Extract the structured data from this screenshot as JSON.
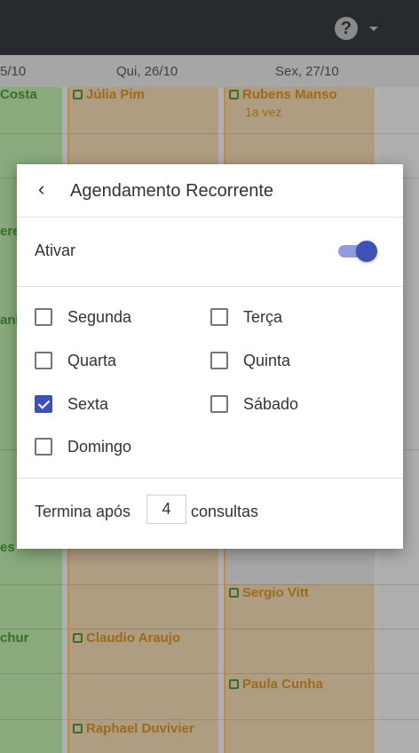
{
  "calendar": {
    "header": {
      "col0": "5/10",
      "col1": "Qui, 26/10",
      "col2": "Sex, 27/10"
    },
    "events": {
      "col0_top": "Costa",
      "col0_mid1": "ere",
      "col0_mid2": "anh",
      "col0_low1": "es",
      "col0_low2": "chur",
      "col1_top": "Júlia Pim",
      "col1_mid": "Claudio Araujo",
      "col1_low": "Raphael Duvivier",
      "col2_top": "Rubens Manso",
      "col2_top_sub": "1a vez",
      "col2_mid": "Sergio Vitt",
      "col2_low": "Paula Cunha"
    }
  },
  "dialog": {
    "title": "Agendamento Recorrente",
    "ativar_label": "Ativar",
    "ativar_on": true,
    "days": [
      {
        "label": "Segunda",
        "checked": false
      },
      {
        "label": "Terça",
        "checked": false
      },
      {
        "label": "Quarta",
        "checked": false
      },
      {
        "label": "Quinta",
        "checked": false
      },
      {
        "label": "Sexta",
        "checked": true
      },
      {
        "label": "Sábado",
        "checked": false
      },
      {
        "label": "Domingo",
        "checked": false
      }
    ],
    "ends_prefix": "Termina após",
    "ends_value": "4",
    "ends_suffix": "consultas"
  },
  "colors": {
    "accent": "#3f51b5",
    "topbar": "#2e3135",
    "event_orange": "#c8b393",
    "event_green": "#9bc28f"
  },
  "icons": {
    "help": "question-circle-icon",
    "back": "chevron-left-icon"
  }
}
